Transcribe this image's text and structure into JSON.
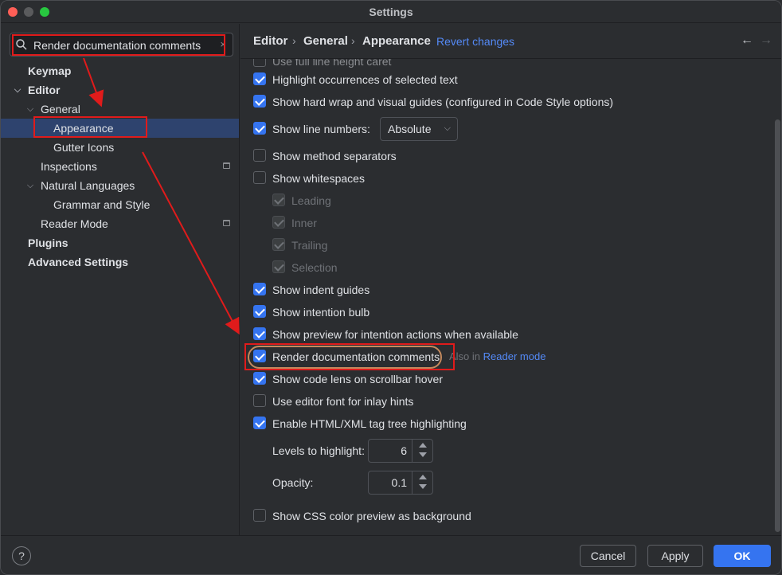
{
  "window": {
    "title": "Settings"
  },
  "search": {
    "value": "Render documentation comments",
    "clear_glyph": "×"
  },
  "sidebar": {
    "items": [
      {
        "label": "Keymap"
      },
      {
        "label": "Editor"
      },
      {
        "label": "General"
      },
      {
        "label": "Appearance"
      },
      {
        "label": "Gutter Icons"
      },
      {
        "label": "Inspections"
      },
      {
        "label": "Natural Languages"
      },
      {
        "label": "Grammar and Style"
      },
      {
        "label": "Reader Mode"
      },
      {
        "label": "Plugins"
      },
      {
        "label": "Advanced Settings"
      }
    ]
  },
  "header": {
    "breadcrumb": [
      "Editor",
      "General",
      "Appearance"
    ],
    "revert": "Revert changes"
  },
  "options": {
    "partial_top": "Use full line height caret",
    "highlight_occurrences": "Highlight occurrences of selected text",
    "hard_wrap": "Show hard wrap and visual guides (configured in Code Style options)",
    "line_numbers": "Show line numbers:",
    "line_numbers_value": "Absolute",
    "method_separators": "Show method separators",
    "whitespaces": "Show whitespaces",
    "leading": "Leading",
    "inner": "Inner",
    "trailing": "Trailing",
    "selection": "Selection",
    "indent_guides": "Show indent guides",
    "intention_bulb": "Show intention bulb",
    "preview_intention": "Show preview for intention actions when available",
    "render_docs": "Render documentation comments",
    "also_in": "Also in",
    "reader_mode_link": "Reader mode",
    "code_lens": "Show code lens on scrollbar hover",
    "editor_font_inlay": "Use editor font for inlay hints",
    "html_xml_tree": "Enable HTML/XML tag tree highlighting",
    "levels_label": "Levels to highlight:",
    "levels_value": "6",
    "opacity_label": "Opacity:",
    "opacity_value": "0.1",
    "css_color_preview": "Show CSS color preview as background"
  },
  "footer": {
    "help": "?",
    "cancel": "Cancel",
    "apply": "Apply",
    "ok": "OK"
  },
  "colors": {
    "accent": "#3574f0",
    "selection": "#2e436e",
    "link": "#548af7",
    "annotation": "#e01b1b"
  }
}
